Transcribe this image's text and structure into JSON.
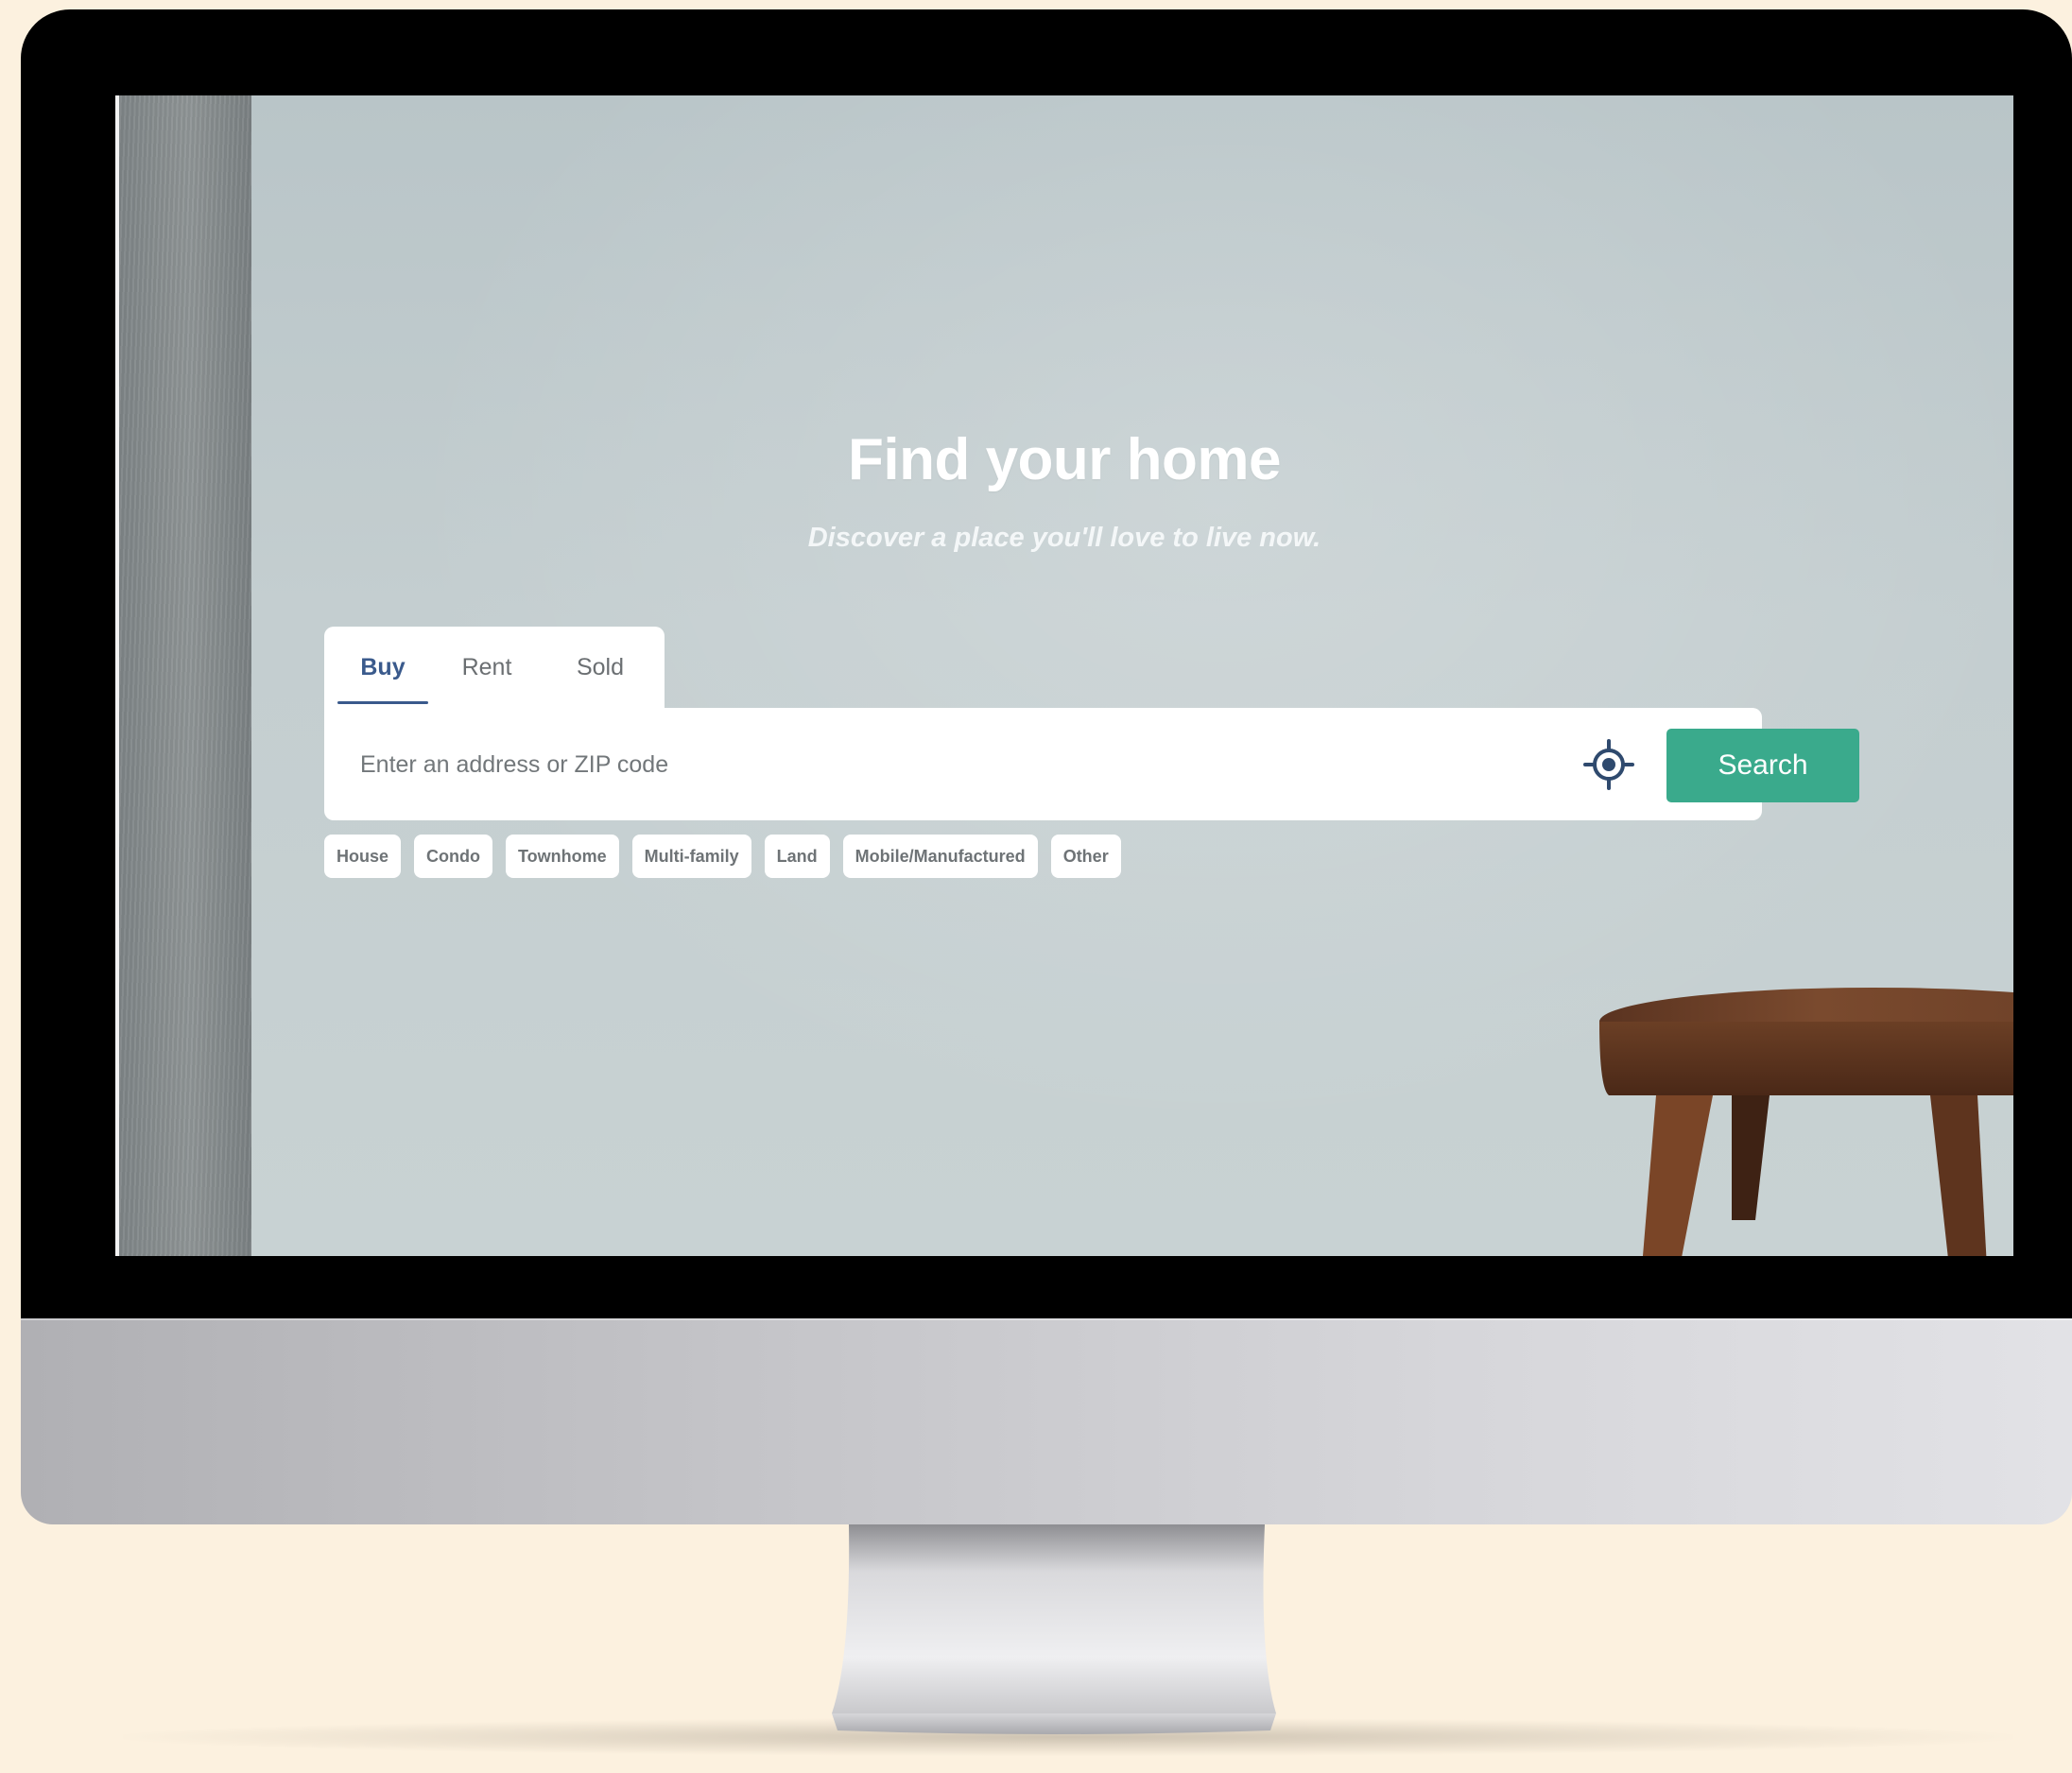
{
  "hero": {
    "title": "Find your home",
    "subtitle": "Discover a place you'll love to live now."
  },
  "tabs": [
    {
      "label": "Buy",
      "active": true
    },
    {
      "label": "Rent",
      "active": false
    },
    {
      "label": "Sold",
      "active": false
    }
  ],
  "search": {
    "placeholder": "Enter an address or ZIP code",
    "value": "",
    "locate_icon": "crosshair-icon",
    "button_label": "Search"
  },
  "property_types": [
    "House",
    "Condo",
    "Townhome",
    "Multi-family",
    "Land",
    "Mobile/Manufactured",
    "Other"
  ],
  "colors": {
    "accent": "#3aaa8c",
    "active_tab": "#3a5a8c",
    "background": "#fcf1df"
  }
}
